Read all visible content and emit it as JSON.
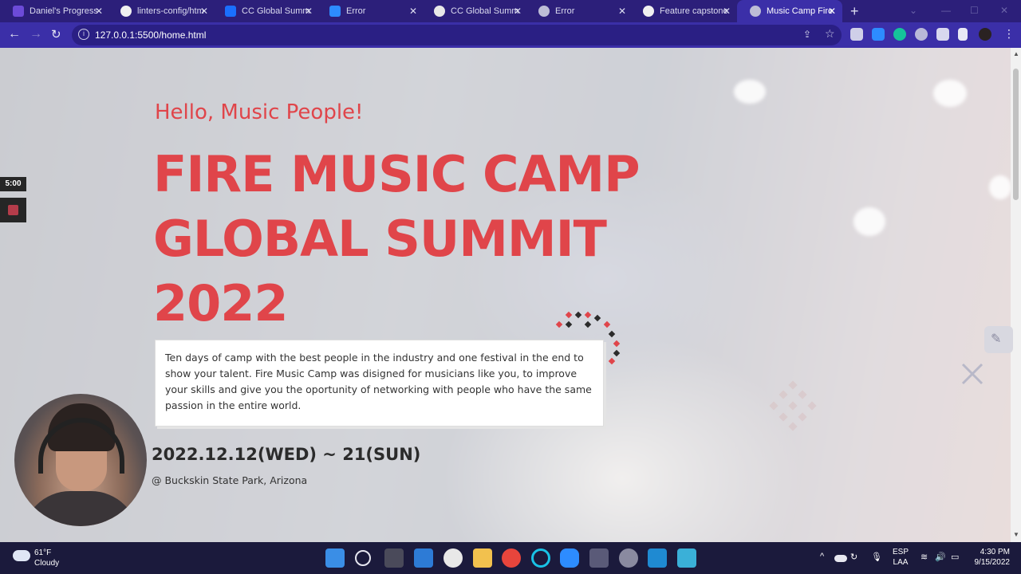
{
  "browser": {
    "tabs": [
      {
        "title": "Daniel's Progress",
        "favicon": "microverse-icon",
        "color": "#6c4bd8",
        "active": false
      },
      {
        "title": "linters-config/htm",
        "favicon": "github-icon",
        "color": "#f0f0f0",
        "active": false
      },
      {
        "title": "CC Global Summ",
        "favicon": "behance-icon",
        "color": "#1a6fff",
        "active": false
      },
      {
        "title": "Error",
        "favicon": "zoom-icon",
        "color": "#2d8cff",
        "active": false
      },
      {
        "title": "CC Global Summ",
        "favicon": "codepen-icon",
        "color": "#e8e8e8",
        "active": false
      },
      {
        "title": "Error",
        "favicon": "globe-icon",
        "color": "#bdbdd6",
        "active": false
      },
      {
        "title": "Feature capstone",
        "favicon": "github-icon",
        "color": "#f0f0f0",
        "active": false
      },
      {
        "title": "Music Camp Fire",
        "favicon": "globe-icon",
        "color": "#bdbdd6",
        "active": true
      }
    ],
    "url": "127.0.0.1:5500/home.html"
  },
  "page": {
    "greeting": "Hello, Music People!",
    "headline_line1": "FIRE MUSIC CAMP",
    "headline_line2": "GLOBAL SUMMIT",
    "headline_line3": "2022",
    "description": "Ten days of camp with the best people in the industry and one festival in the end to show your talent. Fire Music Camp was disigned for musicians like you, to improve your skills and give you the oportunity of networking with people who have the same passion in the entire world.",
    "date": "2022.12.12(WED) ~ 21(SUN)",
    "venue": "@ Buckskin State Park, Arizona",
    "accent_color": "#e0454a"
  },
  "recorder": {
    "timer": "5:00"
  },
  "taskbar": {
    "weather_temp": "61°F",
    "weather_cond": "Cloudy",
    "lang_line1": "ESP",
    "lang_line2": "LAA",
    "time": "4:30 PM",
    "date": "9/15/2022"
  }
}
